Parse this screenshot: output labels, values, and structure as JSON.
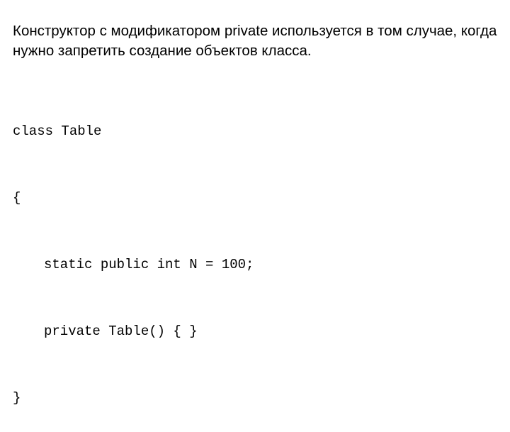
{
  "description": "Конструктор с модификатором private используется в том случае, когда нужно запретить создание объектов класса.",
  "code": {
    "line1": "class Table",
    "line2": "{",
    "line3": "static public int N = 100;",
    "line4": "private Table() { }",
    "line5": "}"
  }
}
